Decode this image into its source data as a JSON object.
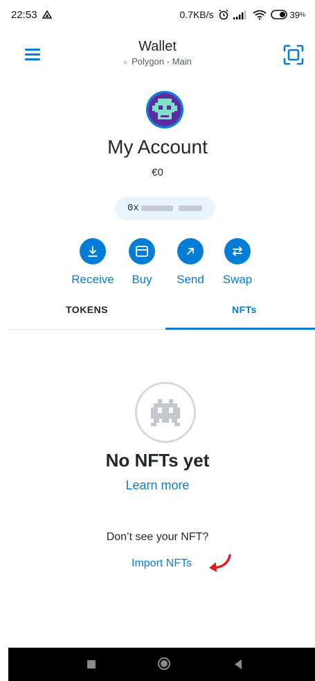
{
  "status_bar": {
    "time": "22:53",
    "network_speed": "0.7KB/s",
    "battery": "39"
  },
  "header": {
    "title": "Wallet",
    "network": "Polygon - Main"
  },
  "account": {
    "name": "My Account",
    "balance": "€0",
    "address_prefix": "0x"
  },
  "actions": [
    {
      "label": "Receive",
      "icon": "download-icon"
    },
    {
      "label": "Buy",
      "icon": "card-icon"
    },
    {
      "label": "Send",
      "icon": "arrow-up-right-icon"
    },
    {
      "label": "Swap",
      "icon": "swap-icon"
    }
  ],
  "tabs": {
    "tokens": "TOKENS",
    "nfts": "NFTs",
    "active": "nfts"
  },
  "empty_state": {
    "title": "No NFTs yet",
    "learn_more": "Learn more",
    "prompt": "Don’t see your NFT?",
    "import": "Import NFTs"
  },
  "colors": {
    "accent": "#037dd6",
    "text": "#24272a",
    "annotation_arrow": "#e01b24"
  }
}
